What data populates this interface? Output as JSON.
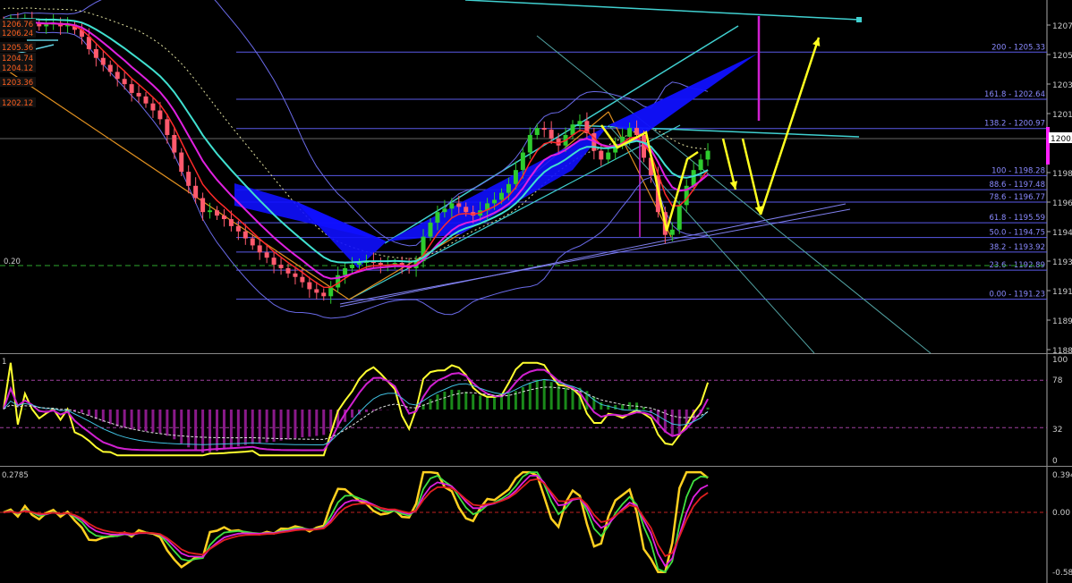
{
  "colors": {
    "background": "#000000",
    "bull_candle": "#2ecc2e",
    "bear_candle": "#ff5a6e",
    "ma_red": "#ff2a2a",
    "ma_magenta": "#e020e0",
    "ma_cyan": "#40e0d0",
    "bands": "#6a6ae8",
    "fib_lines": "#5a5ae8",
    "fib_text": "#8a8aff",
    "pattern_fill": "#1010ff",
    "arrows": "#ffff20",
    "target_line": "#d020d0",
    "channel": "#40d0d0",
    "orange_line": "#e09020",
    "axis_text": "#cccccc"
  },
  "chart_data": [
    {
      "type": "line",
      "panel": "price",
      "ylim": [
        1188,
        1208
      ],
      "price_ticks": [
        "1207",
        "1205",
        "1203",
        "1201",
        "1200",
        "1198",
        "1196",
        "1194",
        "1193",
        "1191",
        "1189",
        "1188"
      ],
      "left_level_labels": [
        "1206.76",
        "1206.24",
        "1205.36",
        "1204.74",
        "1204.12",
        "1203.36",
        "1202.12"
      ],
      "left_label": "0.20",
      "current_price": "1200.",
      "fib_levels": [
        {
          "label": "200 - 1205.33",
          "value": 1205.33
        },
        {
          "label": "161.8 - 1202.64",
          "value": 1202.64
        },
        {
          "label": "138.2 - 1200.97",
          "value": 1200.97
        },
        {
          "label": "100 - 1198.28",
          "value": 1198.28
        },
        {
          "label": "88.6 - 1197.48",
          "value": 1197.48
        },
        {
          "label": "78.6 - 1196.77",
          "value": 1196.77
        },
        {
          "label": "61.8 - 1195.59",
          "value": 1195.59
        },
        {
          "label": "50.0 - 1194.75",
          "value": 1194.75
        },
        {
          "label": "38.2 - 1193.92",
          "value": 1193.92
        },
        {
          "label": "23.6 - 1192.89",
          "value": 1192.89
        },
        {
          "label": "0.00 - 1191.23",
          "value": 1191.23
        }
      ],
      "close": [
        1207.0,
        1207.1,
        1206.9,
        1207.2,
        1207.0,
        1206.8,
        1206.9,
        1207.0,
        1206.8,
        1206.9,
        1206.6,
        1206.2,
        1205.5,
        1205.0,
        1204.6,
        1204.2,
        1203.8,
        1203.5,
        1203.0,
        1202.8,
        1202.4,
        1202.0,
        1201.5,
        1200.6,
        1199.6,
        1198.5,
        1197.7,
        1197.0,
        1196.2,
        1196.3,
        1196.0,
        1195.8,
        1195.4,
        1195.1,
        1194.7,
        1194.3,
        1193.9,
        1193.6,
        1193.2,
        1193.0,
        1192.7,
        1192.5,
        1192.2,
        1191.8,
        1191.6,
        1191.4,
        1191.9,
        1192.6,
        1193.0,
        1193.2,
        1193.3,
        1193.4,
        1193.3,
        1193.2,
        1193.2,
        1193.3,
        1193.1,
        1193.0,
        1193.4,
        1194.8,
        1195.6,
        1196.2,
        1196.4,
        1196.7,
        1196.5,
        1196.2,
        1196.0,
        1196.3,
        1196.7,
        1196.9,
        1197.3,
        1197.8,
        1198.6,
        1199.6,
        1200.6,
        1201.0,
        1200.9,
        1200.4,
        1200.0,
        1200.6,
        1201.2,
        1201.4,
        1200.7,
        1199.7,
        1199.2,
        1199.6,
        1200.1,
        1200.5,
        1201.0,
        1200.6,
        1199.3,
        1198.3,
        1196.2,
        1194.9,
        1195.2,
        1196.6,
        1197.7,
        1198.6,
        1199.2,
        1199.7
      ]
    },
    {
      "type": "line",
      "panel": "oscillator",
      "ylim": [
        0,
        100
      ],
      "ticks": [
        "100",
        "78",
        "32",
        "0"
      ],
      "levels": [
        78,
        32
      ]
    },
    {
      "type": "line",
      "panel": "momentum",
      "ylim": [
        -0.588,
        0.394
      ],
      "ticks": [
        "0.394",
        "0.00",
        "-0.588"
      ],
      "left_label": "0.2785"
    }
  ]
}
